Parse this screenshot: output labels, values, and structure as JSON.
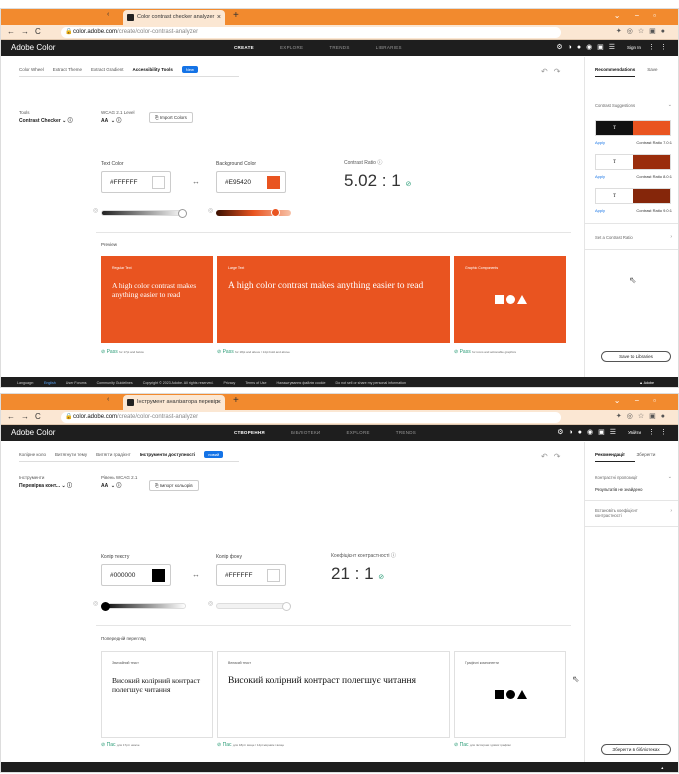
{
  "colors": {
    "orange": "#E95420",
    "accent": "#1473e6",
    "pass": "#2d9d78",
    "dark": "#1e1e1e"
  },
  "shots": [
    {
      "browser": {
        "tab_title": "Color contrast checker analyzer",
        "url_host": "color.adobe.com",
        "url_path": "/create/color-contrast-analyzer"
      },
      "app": {
        "brand": "Adobe Color",
        "menu": [
          "CREATE",
          "EXPLORE",
          "TRENDS",
          "LIBRARIES"
        ],
        "signin": "Sign In"
      },
      "subtabs": [
        "Color Wheel",
        "Extract Theme",
        "Extract Gradient",
        "Accessibility Tools"
      ],
      "badge": "New",
      "tools_label": "Tools",
      "tools_value": "Contrast Checker",
      "wcag_label": "WCAG 2.1 Level",
      "wcag_value": "AA",
      "import_label": "Import Colors",
      "text_color_label": "Text Color",
      "text_color": "#FFFFFF",
      "bg_color_label": "Background Color",
      "bg_color": "#E95420",
      "ratio_label": "Contrast Ratio",
      "ratio": "5.02 : 1",
      "preview_label": "Preview",
      "cards": [
        {
          "title": "Regular Text",
          "body": "A high color contrast makes anything easier to read"
        },
        {
          "title": "Large Text",
          "body": "A high color contrast makes anything easier to read"
        },
        {
          "title": "Graphic Components",
          "body": ""
        }
      ],
      "pass": [
        {
          "label": "Pass",
          "note": "for 17pt and below"
        },
        {
          "label": "Pass",
          "note": "for 18pt and above / 14pt bold and above"
        },
        {
          "label": "Pass",
          "note": "for icons and actionable graphics"
        }
      ],
      "panel": {
        "tabs": [
          "Recommendations",
          "Save"
        ],
        "suggestions_label": "Contrast Suggestions",
        "apply": "Apply",
        "ratios": [
          "Contrast Ratio 7.0:1",
          "Contrast Ratio 8.0:1",
          "Contrast Ratio 9.0:1"
        ],
        "no_results": "",
        "set_ratio": "Set a Contrast Ratio",
        "save_btn": "Save to Libraries"
      },
      "footer": [
        "Language:",
        "English",
        "User Forums",
        "Community Guidelines",
        "Copyright © 2023 Adobe. All rights reserved.",
        "Privacy",
        "Terms of Use",
        "Налаштування файлів cookie",
        "Do not sell or share my personal information"
      ],
      "adobe": "Adobe"
    },
    {
      "browser": {
        "tab_title": "Інструмент аналізатора перевір",
        "url_host": "color.adobe.com",
        "url_path": "/create/color-contrast-analyzer"
      },
      "app": {
        "brand": "Adobe Color",
        "menu": [
          "СТВОРЕННЯ",
          "БІБЛІОТЕКИ",
          "EXPLORE",
          "TRENDS"
        ],
        "signin": "Увійти"
      },
      "subtabs": [
        "Колірне коло",
        "Витягнути тему",
        "Витягти градієнт",
        "Інструменти доступності"
      ],
      "badge": "новий",
      "tools_label": "Інструменти",
      "tools_value": "Перевірка конт...",
      "wcag_label": "Рівень WCAG 2.1",
      "wcag_value": "AA",
      "import_label": "Імпорт кольорів",
      "text_color_label": "Колір тексту",
      "text_color": "#000000",
      "bg_color_label": "Колір фону",
      "bg_color": "#FFFFFF",
      "ratio_label": "Коефіцієнт контрастності",
      "ratio": "21 : 1",
      "preview_label": "Попередній перегляд",
      "cards": [
        {
          "title": "Звичайний текст",
          "body": "Високий колірний контраст полегшує читання"
        },
        {
          "title": "Великий текст",
          "body": "Високий колірний контраст полегшує читання"
        },
        {
          "title": "Графічні компоненти",
          "body": ""
        }
      ],
      "pass": [
        {
          "label": "Пас",
          "note": "для 17pt і нижче"
        },
        {
          "label": "Пас",
          "note": "для 18pt і вище / 14pt жирним і вище"
        },
        {
          "label": "Пас",
          "note": "для піктограм і дієвої графіки"
        }
      ],
      "panel": {
        "tabs": [
          "Рекомендації",
          "Зберегти"
        ],
        "suggestions_label": "Контрастні пропозиції",
        "apply": "",
        "ratios": [],
        "no_results": "Результатів не знайдено",
        "set_ratio": "Встановіть коефіцієнт контрастності",
        "save_btn": "Зберегти в бібліотеках"
      },
      "footer": [],
      "adobe": ""
    }
  ]
}
